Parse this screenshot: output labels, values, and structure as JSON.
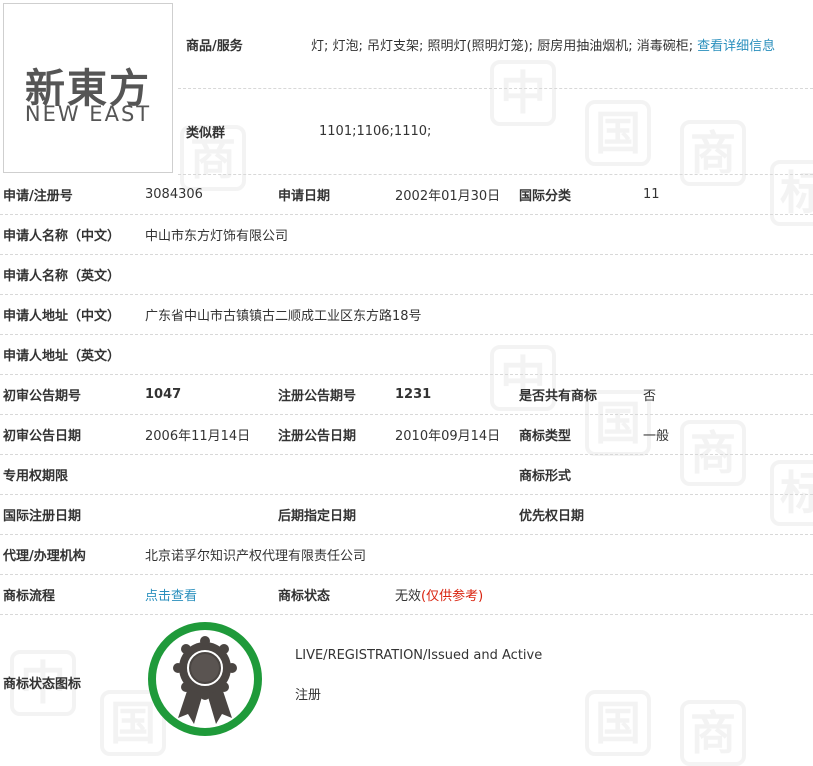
{
  "logo": {
    "chinese": "新東方",
    "english": "NEW EAST"
  },
  "goods": {
    "label": "商品/服务",
    "value": "灯; 灯泡; 吊灯支架; 照明灯(照明灯笼); 厨房用抽油烟机; 消毒碗柜;",
    "link": "查看详细信息"
  },
  "similar": {
    "label": "类似群",
    "value": "1101;1106;1110;"
  },
  "reg": {
    "no_label": "申请/注册号",
    "no_value": "3084306",
    "date_label": "申请日期",
    "date_value": "2002年01月30日",
    "class_label": "国际分类",
    "class_value": "11"
  },
  "applicant_cn": {
    "label": "申请人名称（中文）",
    "value": "中山市东方灯饰有限公司"
  },
  "applicant_en": {
    "label": "申请人名称（英文）",
    "value": ""
  },
  "address_cn": {
    "label": "申请人地址（中文）",
    "value": "广东省中山市古镇镇古二顺成工业区东方路18号"
  },
  "address_en": {
    "label": "申请人地址（英文）",
    "value": ""
  },
  "pub1": {
    "prelim_no_label": "初审公告期号",
    "prelim_no_value": "1047",
    "reg_no_label": "注册公告期号",
    "reg_no_value": "1231",
    "shared_label": "是否共有商标",
    "shared_value": "否"
  },
  "pub2": {
    "prelim_date_label": "初审公告日期",
    "prelim_date_value": "2006年11月14日",
    "reg_date_label": "注册公告日期",
    "reg_date_value": "2010年09月14日",
    "type_label": "商标类型",
    "type_value": "一般"
  },
  "period": {
    "label": "专用权期限",
    "value": "",
    "form_label": "商标形式",
    "form_value": ""
  },
  "intl": {
    "intl_date_label": "国际注册日期",
    "intl_date_value": "",
    "later_label": "后期指定日期",
    "later_value": "",
    "priority_label": "优先权日期",
    "priority_value": ""
  },
  "agent": {
    "label": "代理/办理机构",
    "value": "北京诺孚尔知识产权代理有限责任公司"
  },
  "flow": {
    "label": "商标流程",
    "link": "点击查看",
    "status_label": "商标状态",
    "status_value": "无效",
    "status_note": "(仅供参考)"
  },
  "status_icon": {
    "label": "商标状态图标",
    "en": "LIVE/REGISTRATION/Issued and Active",
    "cn": "注册"
  },
  "colors": {
    "link": "#2a8fbd",
    "badge_ring": "#1f9a3a",
    "badge_seal": "#4a4542",
    "note_red": "#d9230f"
  },
  "icons": {
    "status_badge": "award-ribbon-icon"
  }
}
